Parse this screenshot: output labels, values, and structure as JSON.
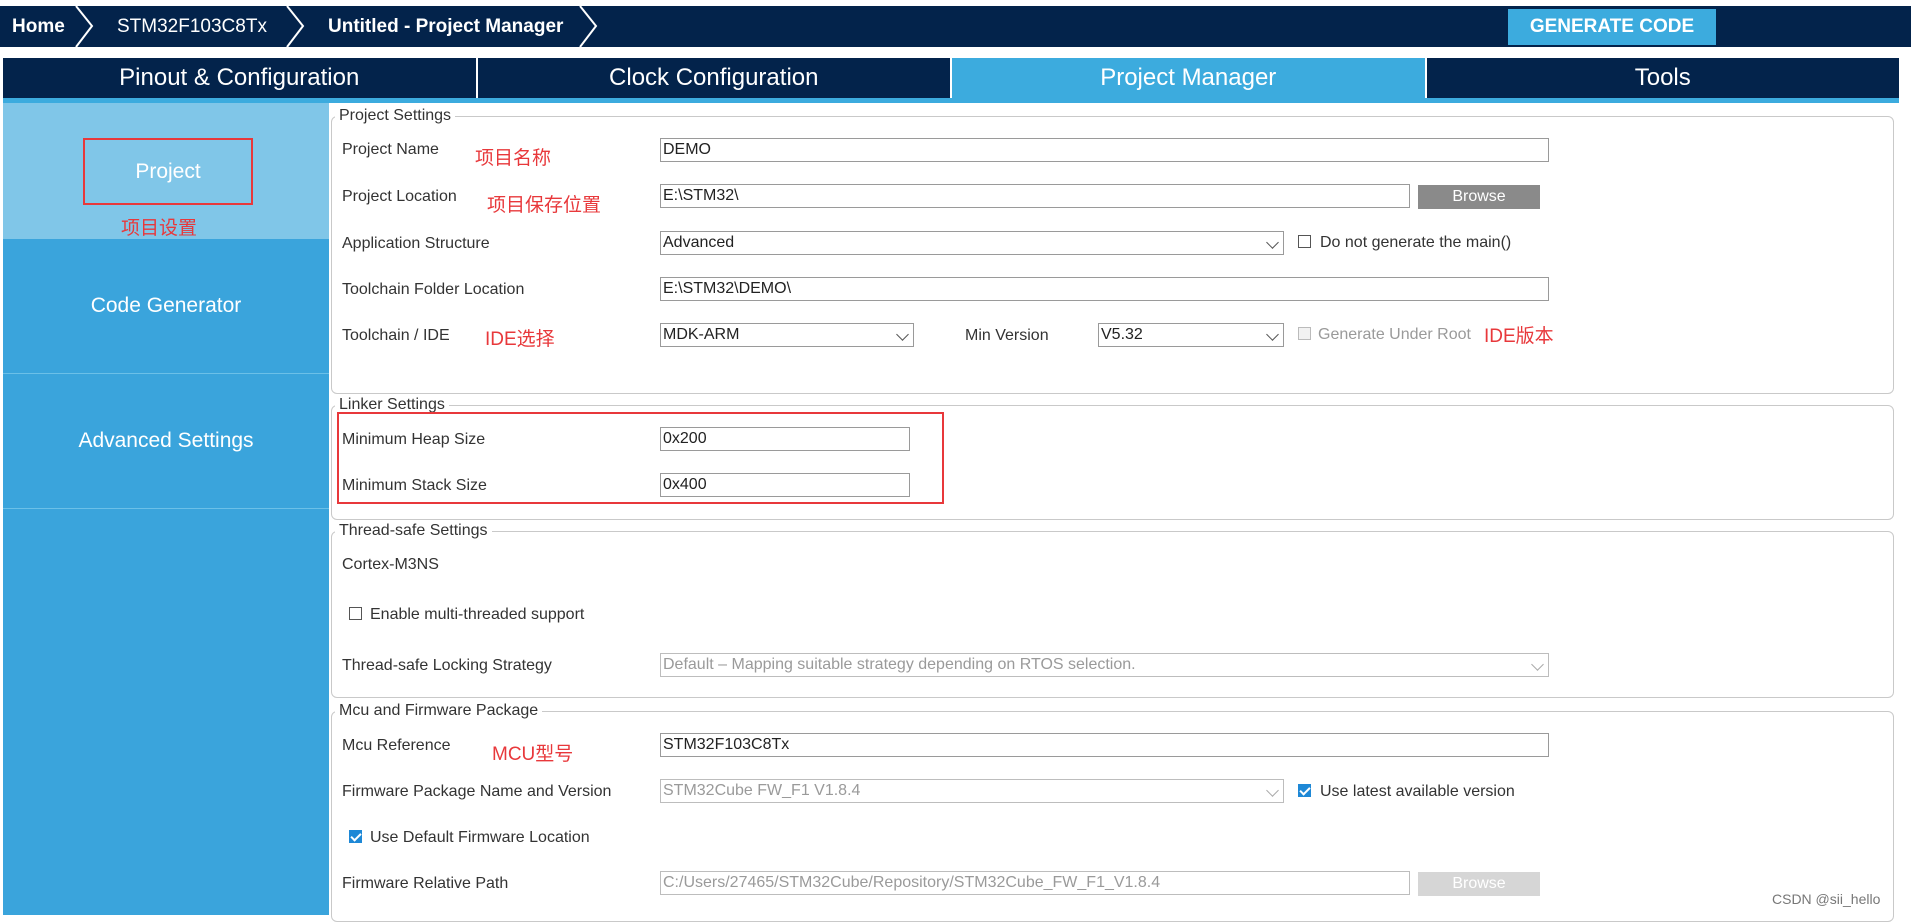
{
  "breadcrumb": {
    "home": "Home",
    "device": "STM32F103C8Tx",
    "project": "Untitled - Project Manager"
  },
  "toolbar": {
    "generate_label": "GENERATE CODE"
  },
  "tabs": [
    {
      "label": "Pinout & Configuration"
    },
    {
      "label": "Clock Configuration"
    },
    {
      "label": "Project Manager",
      "active": true
    },
    {
      "label": "Tools"
    }
  ],
  "sidebar": {
    "project": "Project",
    "project_annotation": "项目设置",
    "code_generator": "Code Generator",
    "advanced": "Advanced Settings"
  },
  "project_settings": {
    "legend": "Project Settings",
    "name_label": "Project Name",
    "name_annotation": "项目名称",
    "name_value": "DEMO",
    "location_label": "Project Location",
    "location_annotation": "项目保存位置",
    "location_value": "E:\\STM32\\",
    "browse": "Browse",
    "structure_label": "Application Structure",
    "structure_value": "Advanced",
    "no_main_label": "Do not generate the main()",
    "toolchain_folder_label": "Toolchain Folder Location",
    "toolchain_folder_value": "E:\\STM32\\DEMO\\",
    "ide_label": "Toolchain / IDE",
    "ide_annotation": "IDE选择",
    "ide_value": "MDK-ARM",
    "min_version_label": "Min Version",
    "min_version_value": "V5.32",
    "under_root_label": "Generate Under Root",
    "version_annotation": "IDE版本"
  },
  "linker_settings": {
    "legend": "Linker Settings",
    "heap_label": "Minimum Heap Size",
    "heap_value": "0x200",
    "stack_label": "Minimum Stack Size",
    "stack_value": "0x400"
  },
  "thread_settings": {
    "legend": "Thread-safe Settings",
    "core": "Cortex-M3NS",
    "multithread_label": "Enable multi-threaded support",
    "locking_label": "Thread-safe Locking Strategy",
    "locking_value": "Default  –  Mapping suitable strategy depending on RTOS selection."
  },
  "mcu_package": {
    "legend": "Mcu and Firmware Package",
    "mcu_label": "Mcu Reference",
    "mcu_annotation": "MCU型号",
    "mcu_value": "STM32F103C8Tx",
    "fw_label": "Firmware Package Name and Version",
    "fw_value": "STM32Cube FW_F1 V1.8.4",
    "latest_label": "Use latest available version",
    "default_location_label": "Use Default Firmware Location",
    "fw_path_label": "Firmware Relative Path",
    "fw_path_value": "C:/Users/27465/STM32Cube/Repository/STM32Cube_FW_F1_V1.8.4",
    "browse": "Browse"
  },
  "watermark": "CSDN @sii_hello",
  "colors": {
    "navy": "#03234b",
    "accent": "#3cabde",
    "annotation": "#e8383b"
  }
}
